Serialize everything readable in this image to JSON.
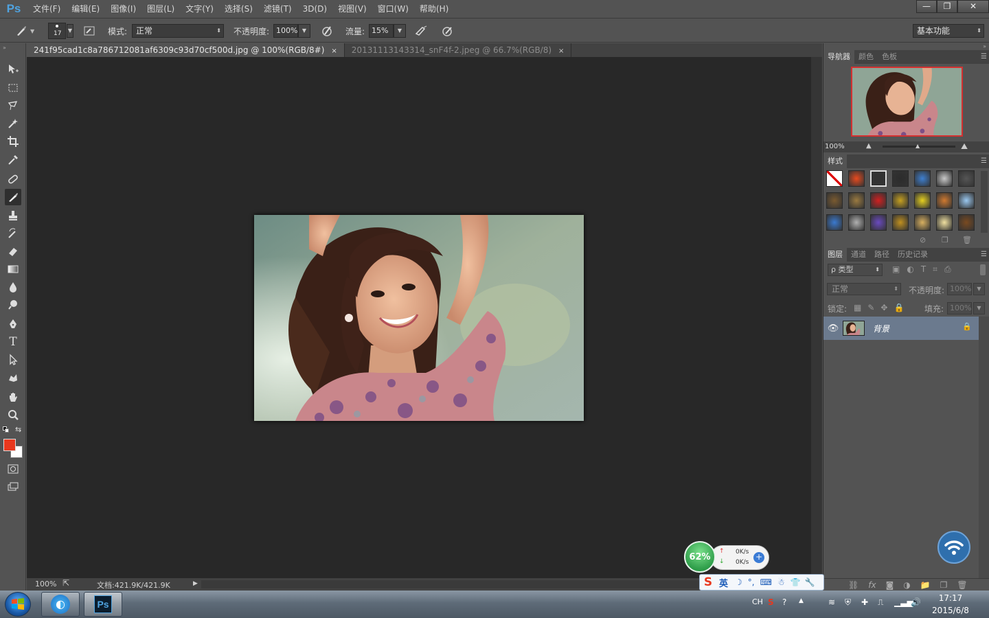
{
  "app": {
    "logo": "Ps"
  },
  "menu": [
    "文件(F)",
    "编辑(E)",
    "图像(I)",
    "图层(L)",
    "文字(Y)",
    "选择(S)",
    "滤镜(T)",
    "3D(D)",
    "视图(V)",
    "窗口(W)",
    "帮助(H)"
  ],
  "window_controls": {
    "minimize": "—",
    "restore": "❐",
    "close": "✕"
  },
  "options": {
    "brush_size": "17",
    "mode_label": "模式:",
    "mode_value": "正常",
    "opacity_label": "不透明度:",
    "opacity_value": "100%",
    "flow_label": "流量:",
    "flow_value": "15%",
    "workspace": "基本功能"
  },
  "tabs": [
    {
      "title": "241f95cad1c8a786712081af6309c93d70cf500d.jpg @ 100%(RGB/8#)",
      "close": "×",
      "active": true
    },
    {
      "title": "20131113143314_snF4f-2.jpeg @ 66.7%(RGB/8)",
      "close": "×",
      "active": false
    }
  ],
  "status": {
    "zoom": "100%",
    "doc": "文档:421.9K/421.9K",
    "arrow": "▶"
  },
  "colors": {
    "foreground": "#e8381e",
    "background": "#ffffff",
    "accent": "#4fa3e0"
  },
  "navigator": {
    "tabs": [
      "导航器",
      "颜色",
      "色板"
    ],
    "zoom": "100%"
  },
  "styles_panel": {
    "title": "样式"
  },
  "layers": {
    "tabs": [
      "图层",
      "通道",
      "路径",
      "历史记录"
    ],
    "filter_label": "ρ 类型",
    "blend_mode": "正常",
    "opacity_label": "不透明度:",
    "opacity_value": "100%",
    "lock_label": "锁定:",
    "fill_label": "填充:",
    "fill_value": "100%",
    "layer_name": "背景"
  },
  "net_widget": {
    "percent": "62%",
    "up": "0K/s",
    "down": "0K/s"
  },
  "ime": {
    "lang": "英"
  },
  "tray": {
    "lang": "CH"
  },
  "clock": {
    "time": "17:17",
    "date": "2015/6/8"
  }
}
